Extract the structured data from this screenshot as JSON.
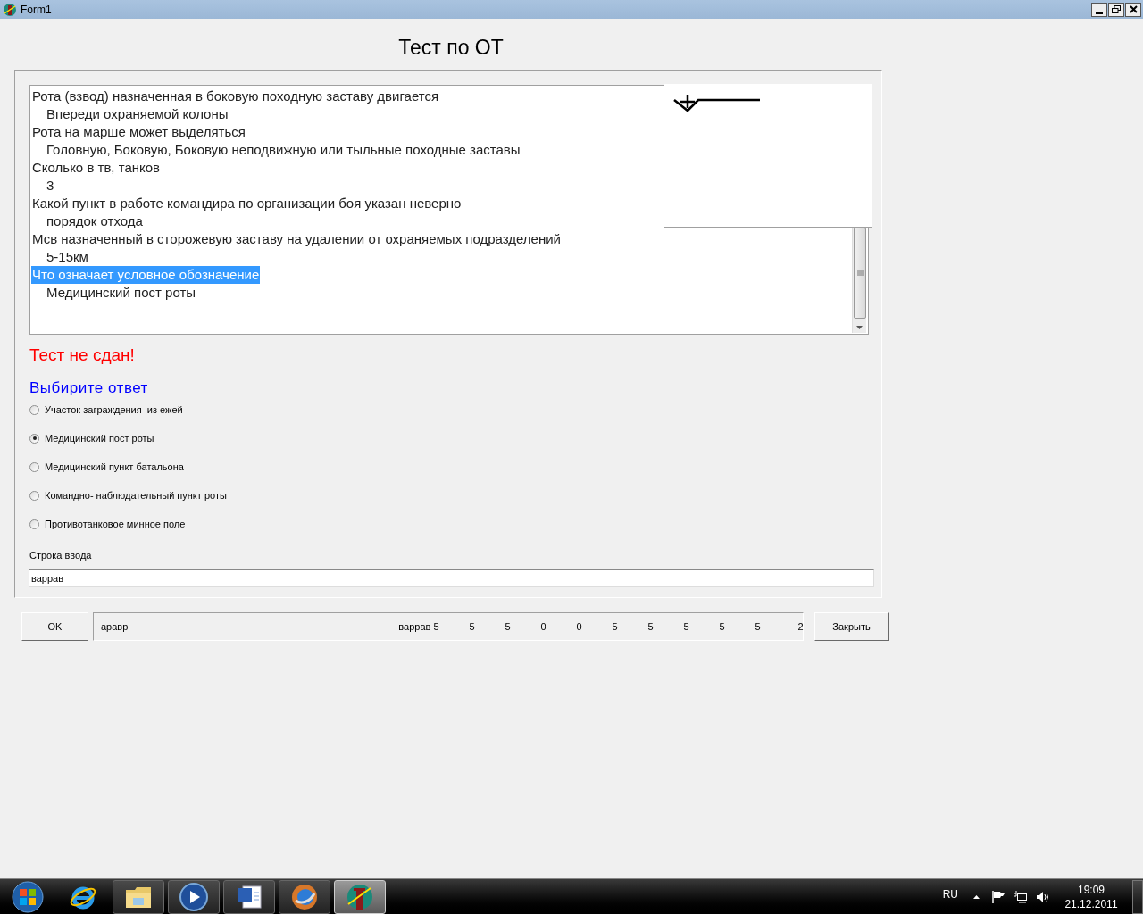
{
  "window": {
    "title": "Form1"
  },
  "heading": "Тест по ОТ",
  "log": [
    {
      "text": "Рота (взвод) назначенная в боковую походную заставу двигается",
      "selected": false,
      "children": [
        {
          "text": "Впереди охраняемой колоны"
        }
      ]
    },
    {
      "text": "Рота на марше может выделяться",
      "selected": false,
      "children": [
        {
          "text": "Головную, Боковую, Боковую неподвижную или тыльные походные заставы"
        }
      ]
    },
    {
      "text": "Сколько в тв, танков",
      "selected": false,
      "children": [
        {
          "text": "3"
        }
      ]
    },
    {
      "text": "Какой пункт в работе командира по организации боя указан неверно",
      "selected": false,
      "children": [
        {
          "text": "порядок отхода"
        }
      ]
    },
    {
      "text": "Мсв назначенный в сторожевую заставу на удалении от охраняемых подразделений",
      "selected": false,
      "children": [
        {
          "text": "5-15км"
        }
      ]
    },
    {
      "text": "Что означает условное обозначение",
      "selected": true,
      "children": [
        {
          "text": "Медицинский пост роты"
        }
      ]
    }
  ],
  "result": "Тест не сдан!",
  "prompt": "Выбирите ответ",
  "options": [
    {
      "label": "Участок заграждения  из ежей",
      "selected": false
    },
    {
      "label": "Медицинский пост роты",
      "selected": true
    },
    {
      "label": "Медицинский пункт батальона",
      "selected": false
    },
    {
      "label": "Командно- наблюдательный пункт роты",
      "selected": false
    },
    {
      "label": "Противотанковое минное поле",
      "selected": false
    }
  ],
  "input": {
    "label": "Строка ввода",
    "value": "варрав"
  },
  "ok_button": "OK",
  "status_panel": {
    "text": "аравр",
    "values": [
      "варрав 5",
      "5",
      "5",
      "0",
      "0",
      "5",
      "5",
      "5",
      "5",
      "5",
      "2"
    ]
  },
  "close_button": "Закрыть",
  "taskbar": {
    "items": [
      {
        "kind": "start",
        "selected": false
      },
      {
        "kind": "browser",
        "selected": false
      },
      {
        "kind": "folder",
        "selected": false
      },
      {
        "kind": "player",
        "selected": false
      },
      {
        "kind": "document",
        "selected": false
      },
      {
        "kind": "globe",
        "selected": false
      },
      {
        "kind": "app",
        "selected": true
      }
    ],
    "language": "RU",
    "time": "19:09",
    "date": "21.12.2011"
  }
}
